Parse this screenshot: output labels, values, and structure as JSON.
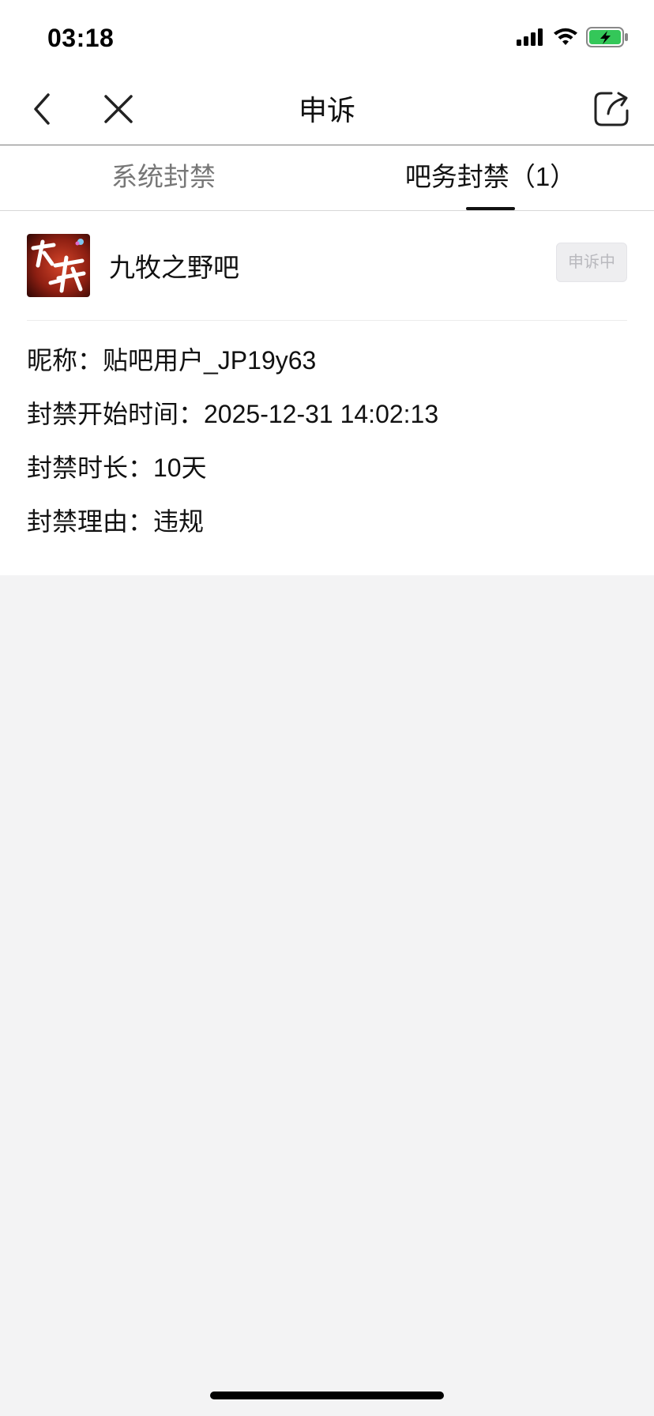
{
  "status_bar": {
    "time": "03:18",
    "icons": [
      "signal-icon",
      "wifi-icon",
      "battery-charging-icon"
    ],
    "battery_color": "#34c759"
  },
  "nav": {
    "title": "申诉",
    "back_icon": "chevron-left-icon",
    "close_icon": "close-icon",
    "share_icon": "share-icon"
  },
  "tabs": [
    {
      "label": "系统封禁",
      "active": false
    },
    {
      "label": "吧务封禁（1）",
      "active": true
    }
  ],
  "ban": {
    "forum_name": "九牧之野吧",
    "status": "申诉中",
    "nickname_line": "昵称：贴吧用户_JP19y63",
    "start_time_line": "封禁开始时间：2025-12-31 14:02:13",
    "duration_line": "封禁时长：10天",
    "reason_line": "封禁理由：违规"
  },
  "colors": {
    "background": "#f3f3f4",
    "surface": "#ffffff",
    "text": "#111111",
    "muted": "#777777"
  }
}
